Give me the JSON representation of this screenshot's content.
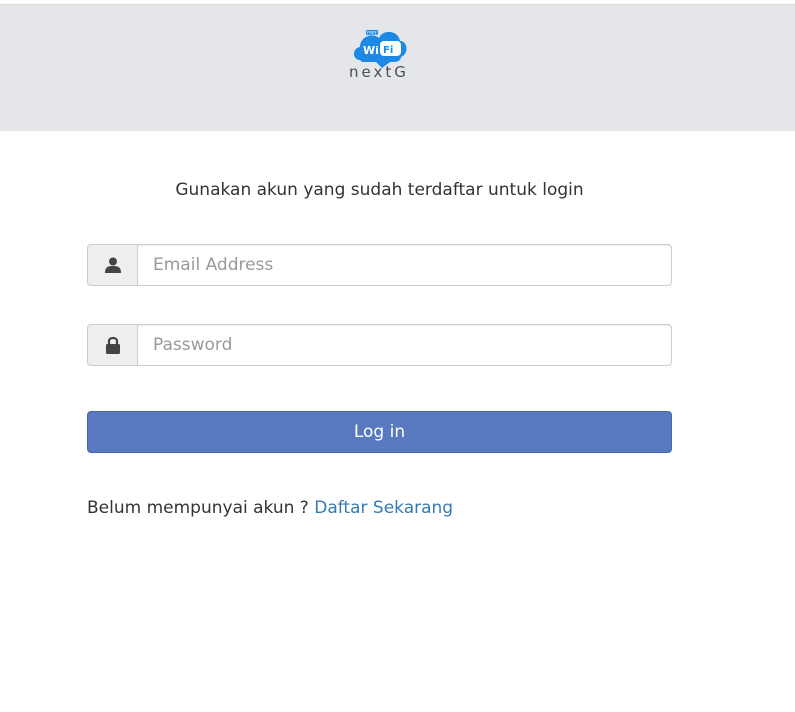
{
  "header": {
    "logo_badge_text": "Wi Fi",
    "logo_small_text": "FREE",
    "logo_wordmark_prefix": "next",
    "logo_wordmark_suffix": "G"
  },
  "form": {
    "subtitle": "Gunakan akun yang sudah terdaftar untuk login",
    "email": {
      "placeholder": "Email Address",
      "value": "",
      "icon": "user-icon"
    },
    "password": {
      "placeholder": "Password",
      "value": "",
      "icon": "lock-icon"
    },
    "login_label": "Log in",
    "register_prompt": "Belum mempunyai akun ?",
    "register_link": "Daftar Sekarang"
  },
  "colors": {
    "header_bg": "#e4e6e9",
    "button_bg": "#5878bf",
    "link": "#337ab7",
    "logo_blue": "#1e88e5"
  }
}
